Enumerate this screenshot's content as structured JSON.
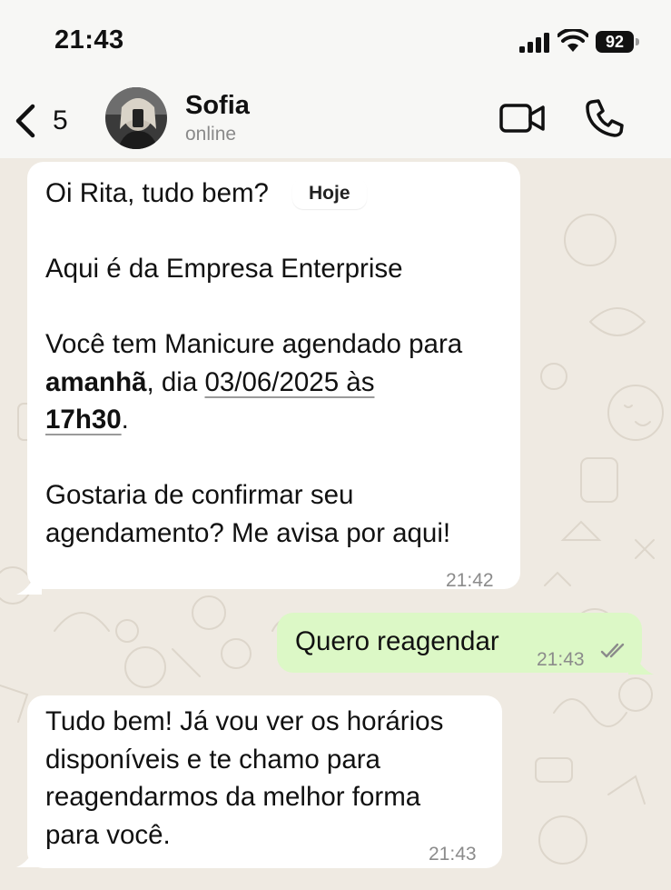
{
  "status_bar": {
    "time": "21:43",
    "battery": "92"
  },
  "header": {
    "back_count": "5",
    "name": "Sofia",
    "status": "online"
  },
  "date_pill": "Hoje",
  "messages": {
    "m1": {
      "greeting": "Oi Rita, tudo bem?",
      "company": "Aqui é da Empresa Enterprise",
      "line3a": "Você tem Manicure agendado para",
      "tomorrow": "amanhã",
      "dia": ", dia ",
      "date_link": "03/06/2025 às",
      "time_link": "17h30",
      "period": ".",
      "line5a": "Gostaria de confirmar seu",
      "line5b": "agendamento? Me avisa por aqui!",
      "time": "21:42"
    },
    "m2": {
      "text": "Quero reagendar",
      "time": "21:43"
    },
    "m3": {
      "line1": "Tudo bem! Já vou ver os horários",
      "line2": "disponíveis e te chamo para",
      "line3": "reagendarmos da melhor forma",
      "line4": "para você.",
      "time": "21:43"
    }
  },
  "colors": {
    "incoming": "#ffffff",
    "outgoing": "#dcf8c6",
    "wallpaper": "#efeae2",
    "header": "#f7f7f5"
  },
  "icons": [
    "back-chevron-icon",
    "video-call-icon",
    "phone-icon",
    "read-receipt-icon",
    "signal-icon",
    "wifi-icon",
    "battery-icon"
  ]
}
